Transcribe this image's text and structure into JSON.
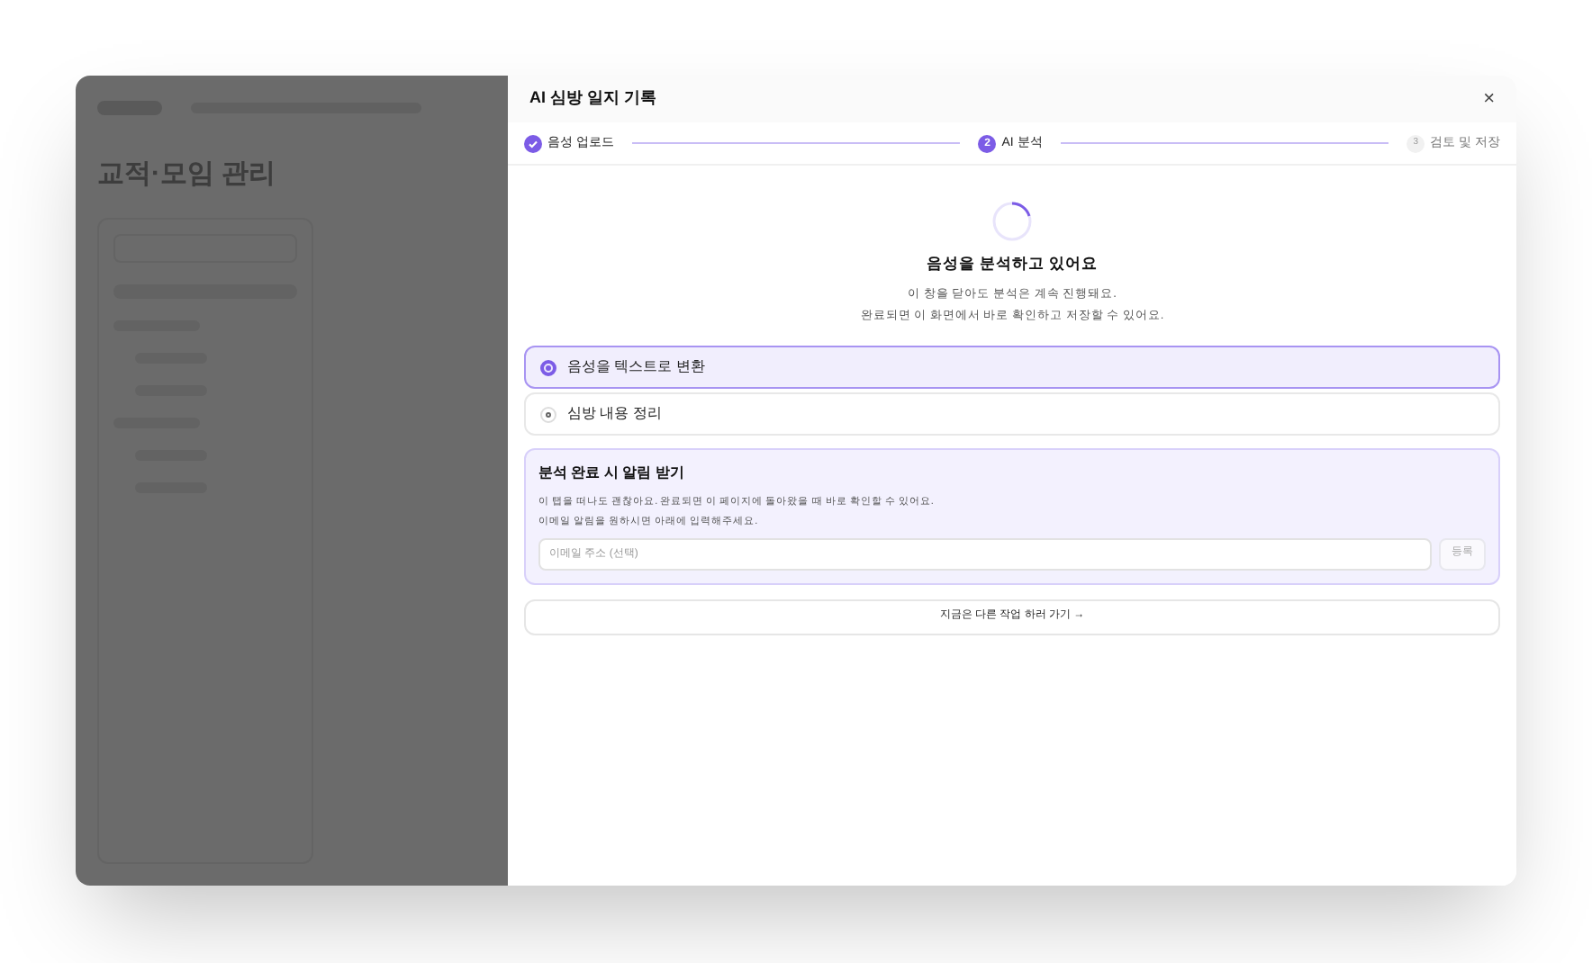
{
  "background": {
    "page_title": "교적·모임 관리"
  },
  "modal": {
    "title": "AI 심방 일지 기록",
    "close": "×",
    "steps": [
      {
        "label": "음성 업로드",
        "completed": true,
        "selected": false
      },
      {
        "number": "2",
        "label": "AI 분석",
        "completed": false,
        "selected": true
      },
      {
        "number": "3",
        "label": "검토 및 저장",
        "completed": false,
        "selected": false
      }
    ],
    "heading": "음성을 분석하고 있어요",
    "description": [
      "이 창을 닫아도 분석은 계속 진행돼요.",
      "완료되면 이 화면에서 바로 확인하고 저장할 수 있어요."
    ],
    "tasks": [
      {
        "label": "음성을 텍스트로 변환",
        "active": true
      },
      {
        "label": "심방 내용 정리",
        "active": false
      }
    ],
    "notify": {
      "title": "분석 완료 시 알림 받기",
      "lines": [
        "이 탭을 떠나도 괜찮아요. 완료되면 이 페이지에 돌아왔을 때 바로 확인할 수 있어요.",
        "이메일 알림을 원하시면 아래에 입력해주세요."
      ],
      "placeholder": "이메일 주소 (선택)",
      "button": "등록"
    },
    "leave_button": "지금은 다른 작업 하러 가기 →"
  }
}
